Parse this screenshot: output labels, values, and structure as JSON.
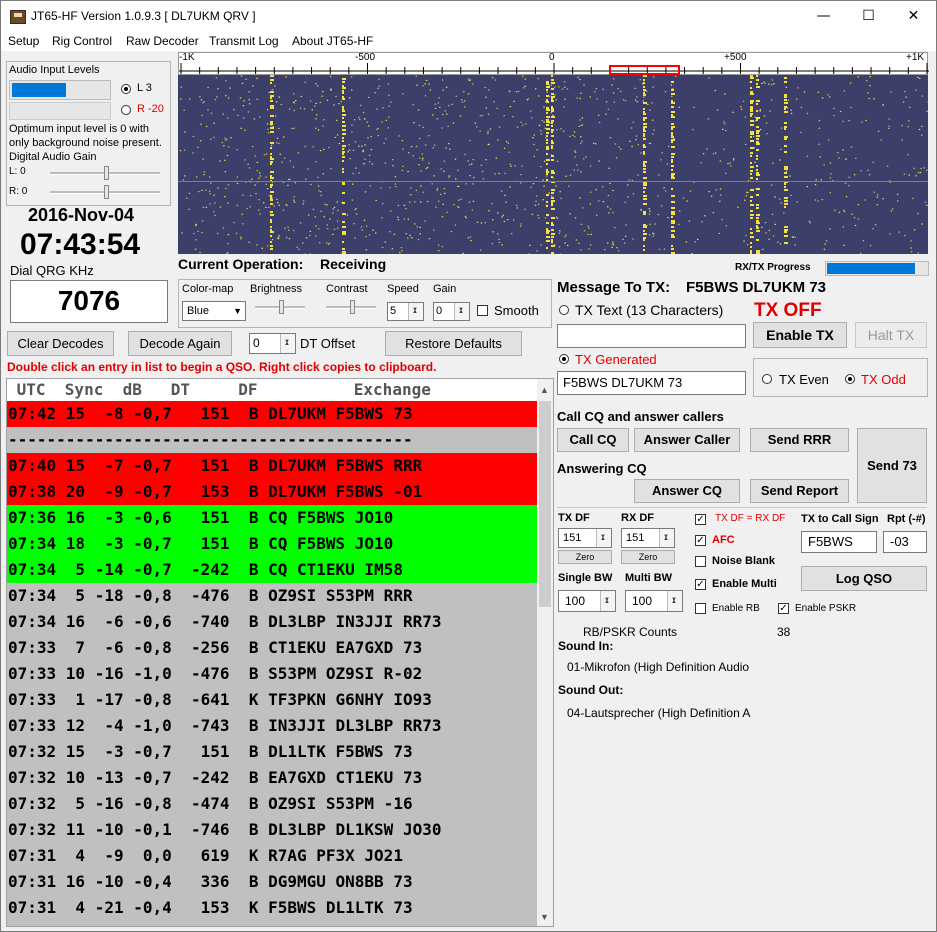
{
  "window": {
    "title": "JT65-HF Version 1.0.9.3  [ DL7UKM QRV ]",
    "minimize": "—",
    "maximize": "☐",
    "close": "✕"
  },
  "menu": [
    "Setup",
    "Rig Control",
    "Raw Decoder",
    "Transmit Log",
    "About JT65-HF"
  ],
  "audio": {
    "title": "Audio Input Levels",
    "level_fraction": 0.56,
    "radio_l": "L 3",
    "radio_r": "R -20",
    "note": "Optimum input level is 0 with only background noise present.",
    "gain_title": "Digital Audio Gain",
    "gain_l": "L: 0",
    "gain_r": "R: 0"
  },
  "date": "2016-Nov-04",
  "time": "07:43:54",
  "dial_label": "Dial QRG KHz",
  "dial_value": "7076",
  "waterfall": {
    "ticks": [
      "-1K",
      "-500",
      "0",
      "+500",
      "+1K"
    ]
  },
  "current_op": {
    "label": "Current Operation:",
    "value": "Receiving"
  },
  "progress": {
    "label": "RX/TX Progress",
    "fraction": 0.88
  },
  "display": {
    "colormap_label": "Color-map",
    "colormap_value": "Blue",
    "brightness_label": "Brightness",
    "contrast_label": "Contrast",
    "speed_label": "Speed",
    "speed_value": "5",
    "gain_label": "Gain",
    "gain_value": "0",
    "smooth_label": "Smooth"
  },
  "controls": {
    "clear_decodes": "Clear Decodes",
    "decode_again": "Decode Again",
    "dt_offset_value": "0",
    "dt_offset_label": "DT Offset",
    "restore_defaults": "Restore Defaults",
    "hint": "Double click an entry in list to begin a QSO.  Right click copies to clipboard."
  },
  "decodes": {
    "header": " UTC  Sync  dB   DT     DF          Exchange",
    "rows": [
      {
        "text": "07:42 15  -8 -0,7   151  B DL7UKM F5BWS 73",
        "bg": "#ff0000"
      },
      {
        "text": "------------------------------------------",
        "bg": "#c0c0c0"
      },
      {
        "text": "07:40 15  -7 -0,7   151  B DL7UKM F5BWS RRR",
        "bg": "#ff0000"
      },
      {
        "text": "07:38 20  -9 -0,7   153  B DL7UKM F5BWS -01",
        "bg": "#ff0000"
      },
      {
        "text": "07:36 16  -3 -0,6   151  B CQ F5BWS JO10",
        "bg": "#00ff00"
      },
      {
        "text": "07:34 18  -3 -0,7   151  B CQ F5BWS JO10",
        "bg": "#00ff00"
      },
      {
        "text": "07:34  5 -14 -0,7  -242  B CQ CT1EKU IM58",
        "bg": "#00ff00"
      },
      {
        "text": "07:34  5 -18 -0,8  -476  B OZ9SI S53PM RRR",
        "bg": "#c0c0c0"
      },
      {
        "text": "07:34 16  -6 -0,6  -740  B DL3LBP IN3JJI RR73",
        "bg": "#c0c0c0"
      },
      {
        "text": "07:33  7  -6 -0,8  -256  B CT1EKU EA7GXD 73",
        "bg": "#c0c0c0"
      },
      {
        "text": "07:33 10 -16 -1,0  -476  B S53PM OZ9SI R-02",
        "bg": "#c0c0c0"
      },
      {
        "text": "07:33  1 -17 -0,8  -641  K TF3PKN G6NHY IO93",
        "bg": "#c0c0c0"
      },
      {
        "text": "07:33 12  -4 -1,0  -743  B IN3JJI DL3LBP RR73",
        "bg": "#c0c0c0"
      },
      {
        "text": "07:32 15  -3 -0,7   151  B DL1LTK F5BWS 73",
        "bg": "#c0c0c0"
      },
      {
        "text": "07:32 10 -13 -0,7  -242  B EA7GXD CT1EKU 73",
        "bg": "#c0c0c0"
      },
      {
        "text": "07:32  5 -16 -0,8  -474  B OZ9SI S53PM -16",
        "bg": "#c0c0c0"
      },
      {
        "text": "07:32 11 -10 -0,1  -746  B DL3LBP DL1KSW JO30",
        "bg": "#c0c0c0"
      },
      {
        "text": "07:31  4  -9  0,0   619  K R7AG PF3X JO21",
        "bg": "#c0c0c0"
      },
      {
        "text": "07:31 16 -10 -0,4   336  B DG9MGU ON8BB 73",
        "bg": "#c0c0c0"
      },
      {
        "text": "07:31  4 -21 -0,4   153  K F5BWS DL1LTK 73",
        "bg": "#c0c0c0"
      }
    ]
  },
  "tx": {
    "message_label": "Message To TX:",
    "message_value": "F5BWS DL7UKM 73",
    "tx_text_label": "TX Text (13 Characters)",
    "tx_off": "TX OFF",
    "enable_tx": "Enable TX",
    "halt_tx": "Halt TX",
    "tx_generated_label": "TX Generated",
    "tx_generated_value": "F5BWS DL7UKM 73",
    "tx_even": "TX Even",
    "tx_odd": "TX Odd"
  },
  "qso": {
    "call_cq_section": "Call CQ and answer callers",
    "call_cq": "Call CQ",
    "answer_caller": "Answer Caller",
    "send_rrr": "Send RRR",
    "send_73": "Send 73",
    "answering_cq_section": "Answering CQ",
    "answer_cq": "Answer CQ",
    "send_report": "Send Report"
  },
  "settings": {
    "tx_df_label": "TX DF",
    "tx_df_value": "151",
    "rx_df_label": "RX DF",
    "rx_df_value": "151",
    "zero": "Zero",
    "tx_eq_rx": "TX DF = RX DF",
    "afc": "AFC",
    "noise_blank": "Noise Blank",
    "enable_multi": "Enable Multi",
    "enable_rb": "Enable RB",
    "enable_pskr": "Enable PSKR",
    "single_bw_label": "Single BW",
    "single_bw_value": "100",
    "multi_bw_label": "Multi BW",
    "multi_bw_value": "100",
    "tx_to_call_label": "TX to Call Sign",
    "tx_to_call_value": "F5BWS",
    "rpt_label": "Rpt (-#)",
    "rpt_value": "-03",
    "log_qso": "Log QSO",
    "counts_label": "RB/PSKR Counts",
    "counts_value": "38",
    "sound_in_label": "Sound In:",
    "sound_in_value": "01-Mikrofon (High Definition Audio",
    "sound_out_label": "Sound Out:",
    "sound_out_value": "04-Lautsprecher (High Definition A"
  },
  "colors": {
    "red": "#ff0000",
    "green": "#00ff00",
    "grey": "#c0c0c0",
    "progress": "#0078d7",
    "waterfall_bg": "#3c3f6a",
    "signal": "#f4e23c"
  }
}
